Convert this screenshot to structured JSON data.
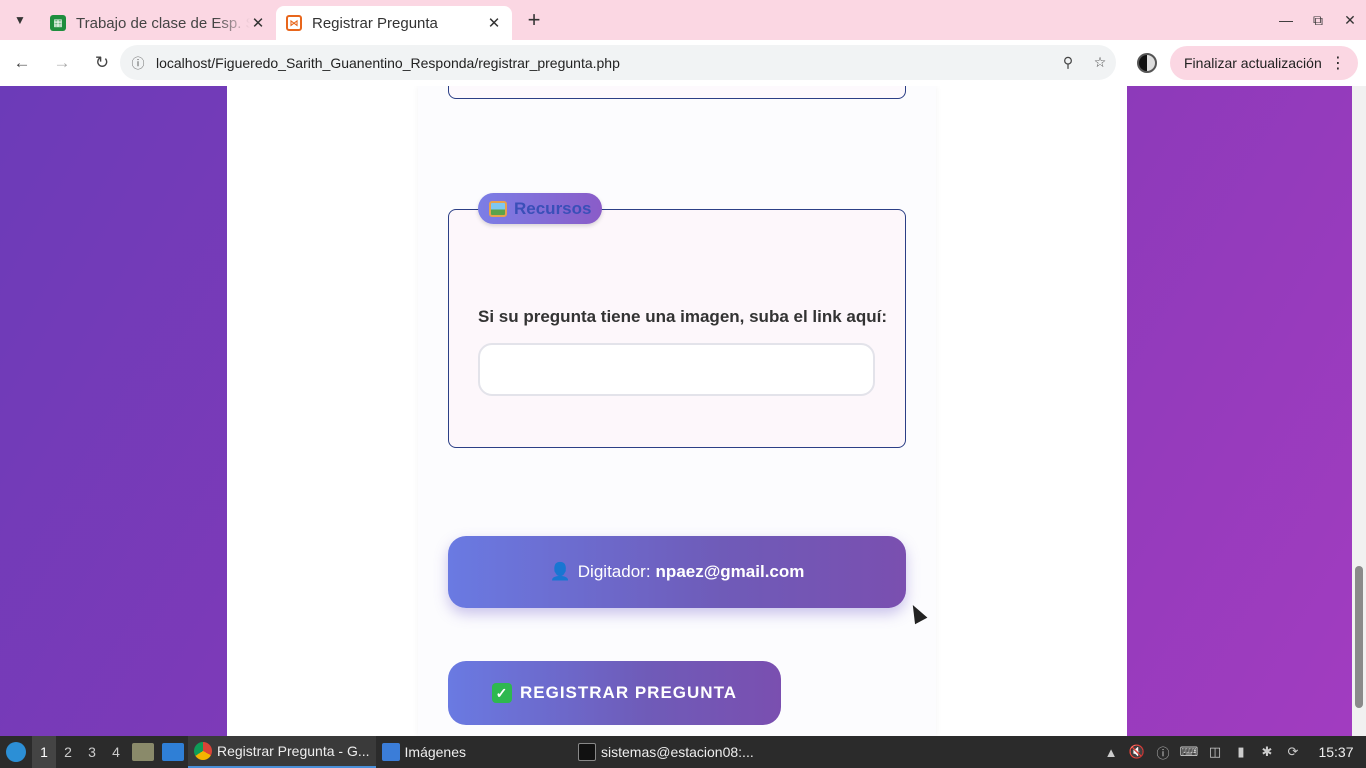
{
  "browser": {
    "tabs": [
      {
        "title": "Trabajo de clase de Esp. S",
        "favicon": "google-sheets-icon",
        "active": false
      },
      {
        "title": "Registrar Pregunta",
        "favicon": "xampp-icon",
        "active": true
      }
    ],
    "new_tab": "+",
    "url": "localhost/Figueredo_Sarith_Guanentino_Responda/registrar_pregunta.php",
    "update_button": "Finalizar actualización"
  },
  "form": {
    "resources_legend": "Recursos",
    "image_link_label": "Si su pregunta tiene una imagen, suba el link aquí:",
    "image_link_value": "",
    "digitador_label": "Digitador:",
    "digitador_email": "npaez@gmail.com",
    "submit_label": "REGISTRAR PREGUNTA"
  },
  "taskbar": {
    "workspaces": [
      "1",
      "2",
      "3",
      "4"
    ],
    "active_workspace": "1",
    "items": [
      {
        "label": "Registrar Pregunta - G...",
        "icon": "chrome-icon",
        "active": true
      },
      {
        "label": "Imágenes",
        "icon": "folder-icon",
        "active": false
      },
      {
        "label": "sistemas@estacion08:...",
        "icon": "terminal-icon",
        "active": false
      }
    ],
    "clock": "15:37"
  },
  "colors": {
    "page_background": "#7b3cb9",
    "accent_gradient_start": "#6a7ae2",
    "accent_gradient_end": "#7a4fb0",
    "fieldset_border": "#2c3f86"
  }
}
